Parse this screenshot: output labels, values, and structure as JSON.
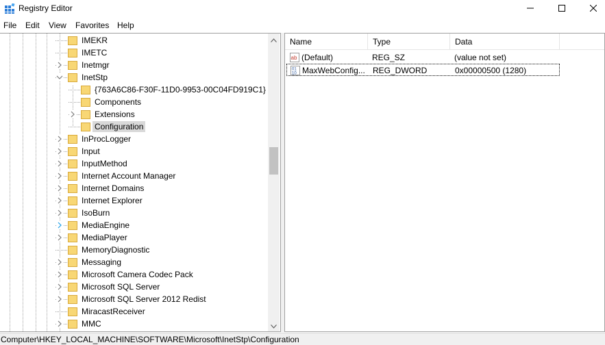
{
  "window": {
    "title": "Registry Editor",
    "app_icon": "regedit-icon",
    "controls": [
      "minimize-icon",
      "maximize-icon",
      "close-icon"
    ]
  },
  "menu": [
    "File",
    "Edit",
    "View",
    "Favorites",
    "Help"
  ],
  "tree": {
    "items": [
      {
        "label": "IMEKR",
        "expander": "none",
        "level": 1
      },
      {
        "label": "IMETC",
        "expander": "none",
        "level": 1
      },
      {
        "label": "Inetmgr",
        "expander": "collapsed",
        "level": 1
      },
      {
        "label": "InetStp",
        "expander": "expanded",
        "level": 1
      },
      {
        "label": "{763A6C86-F30F-11D0-9953-00C04FD919C1}",
        "expander": "none",
        "level": 2
      },
      {
        "label": "Components",
        "expander": "none",
        "level": 2
      },
      {
        "label": "Extensions",
        "expander": "collapsed",
        "level": 2
      },
      {
        "label": "Configuration",
        "expander": "none",
        "level": 2,
        "selected": true
      },
      {
        "label": "InProcLogger",
        "expander": "collapsed",
        "level": 1
      },
      {
        "label": "Input",
        "expander": "collapsed",
        "level": 1
      },
      {
        "label": "InputMethod",
        "expander": "collapsed",
        "level": 1
      },
      {
        "label": "Internet Account Manager",
        "expander": "collapsed",
        "level": 1
      },
      {
        "label": "Internet Domains",
        "expander": "collapsed",
        "level": 1
      },
      {
        "label": "Internet Explorer",
        "expander": "collapsed",
        "level": 1
      },
      {
        "label": "IsoBurn",
        "expander": "collapsed",
        "level": 1
      },
      {
        "label": "MediaEngine",
        "expander": "collapsed-hover",
        "level": 1
      },
      {
        "label": "MediaPlayer",
        "expander": "collapsed",
        "level": 1
      },
      {
        "label": "MemoryDiagnostic",
        "expander": "none",
        "level": 1
      },
      {
        "label": "Messaging",
        "expander": "collapsed",
        "level": 1
      },
      {
        "label": "Microsoft Camera Codec Pack",
        "expander": "collapsed",
        "level": 1
      },
      {
        "label": "Microsoft SQL Server",
        "expander": "collapsed",
        "level": 1
      },
      {
        "label": "Microsoft SQL Server 2012 Redist",
        "expander": "collapsed",
        "level": 1
      },
      {
        "label": "MiracastReceiver",
        "expander": "none",
        "level": 1
      },
      {
        "label": "MMC",
        "expander": "collapsed",
        "level": 1
      }
    ]
  },
  "list": {
    "columns": [
      "Name",
      "Type",
      "Data"
    ],
    "rows": [
      {
        "name": "(Default)",
        "type": "REG_SZ",
        "data": "(value not set)",
        "icon": "string-value-icon"
      },
      {
        "name": "MaxWebConfig...",
        "type": "REG_DWORD",
        "data": "0x00000500 (1280)",
        "icon": "binary-value-icon",
        "focused": true
      }
    ]
  },
  "status": "Computer\\HKEY_LOCAL_MACHINE\\SOFTWARE\\Microsoft\\InetStp\\Configuration",
  "colors": {
    "folder": "#f8d775",
    "folder_edge": "#d8a93a",
    "selection": "#d9d9d9",
    "expander_hover": "#1e9fe8"
  }
}
